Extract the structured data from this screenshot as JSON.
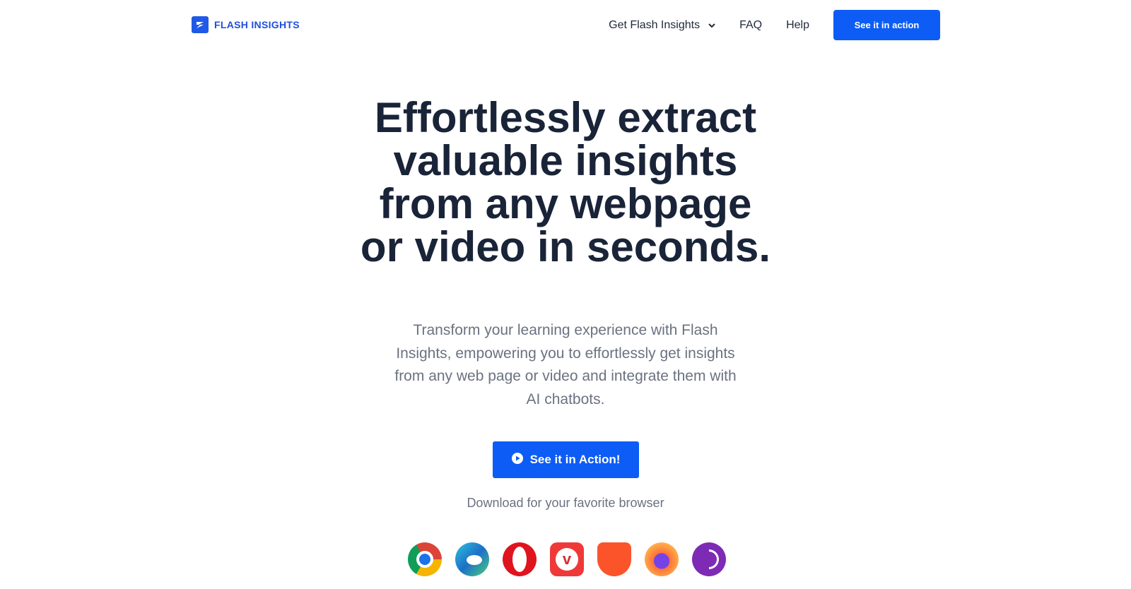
{
  "header": {
    "logo_text": "FLASH INSIGHTS",
    "nav": [
      {
        "label": "Get Flash Insights",
        "icon": "chevron-down-icon"
      },
      {
        "label": "FAQ"
      },
      {
        "label": "Help"
      }
    ],
    "cta_label": "See it in action",
    "accent": "#0d5cf6"
  },
  "hero": {
    "title_lines": [
      "Effortlessly extract",
      "valuable insights",
      "from any webpage",
      "or video in seconds."
    ],
    "subtitle": "Transform your learning experience with Flash Insights, empowering you to effortlessly get insights from any web page or video and integrate them with AI chatbots.",
    "cta_label": "See it in Action!",
    "download_text": "Download for your favorite browser",
    "browsers": [
      "chrome",
      "edge",
      "opera",
      "vivaldi",
      "brave",
      "firefox",
      "tor"
    ]
  }
}
